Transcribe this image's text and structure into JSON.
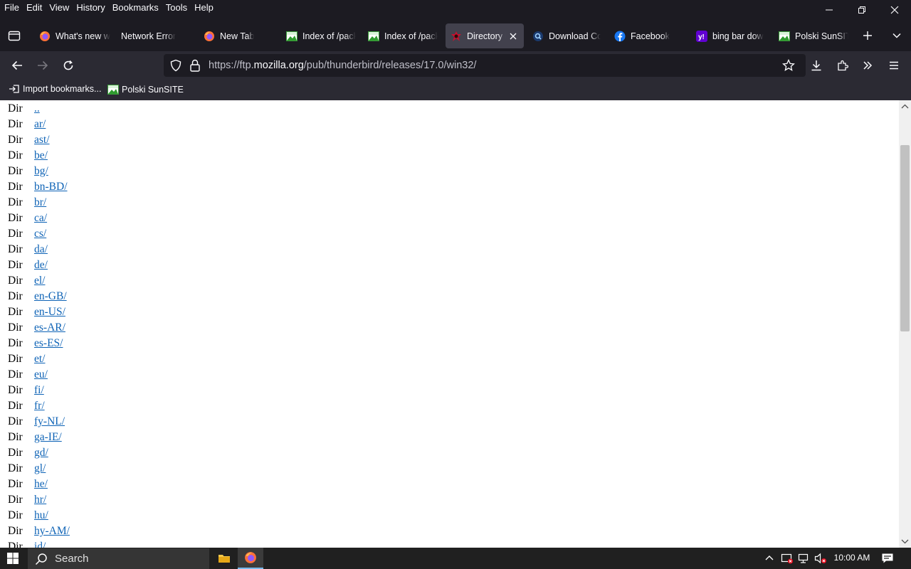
{
  "menu": [
    "File",
    "Edit",
    "View",
    "History",
    "Bookmarks",
    "Tools",
    "Help"
  ],
  "tabs": [
    {
      "label": "What's new w",
      "icon": "firefox-icon"
    },
    {
      "label": "Network Error",
      "icon": "none"
    },
    {
      "label": "New Tab",
      "icon": "firefox-icon"
    },
    {
      "label": "Index of /pack",
      "icon": "sunsite-icon"
    },
    {
      "label": "Index of /pack",
      "icon": "sunsite-icon"
    },
    {
      "label": "Directory L",
      "icon": "directory-icon",
      "active": true
    },
    {
      "label": "Download Co",
      "icon": "search-engine-icon"
    },
    {
      "label": "Facebook",
      "icon": "facebook-icon"
    },
    {
      "label": "bing bar dow",
      "icon": "yahoo-icon"
    },
    {
      "label": "Polski SunSITE",
      "icon": "sunsite-icon"
    }
  ],
  "url": {
    "prefix": "https://ftp.",
    "domain": "mozilla.org",
    "path": "/pub/thunderbird/releases/17.0/win32/"
  },
  "bookmarks": {
    "import": "Import bookmarks...",
    "sunsite": "Polski SunSITE"
  },
  "listing": {
    "kind": "Dir",
    "entries": [
      "..",
      "ar/",
      "ast/",
      "be/",
      "bg/",
      "bn-BD/",
      "br/",
      "ca/",
      "cs/",
      "da/",
      "de/",
      "el/",
      "en-GB/",
      "en-US/",
      "es-AR/",
      "es-ES/",
      "et/",
      "eu/",
      "fi/",
      "fr/",
      "fy-NL/",
      "ga-IE/",
      "gd/",
      "gl/",
      "he/",
      "hr/",
      "hu/",
      "hy-AM/",
      "id/"
    ]
  },
  "taskbar": {
    "search": "Search",
    "time": "10:00 AM"
  },
  "colors": {
    "chrome_dark": "#1c1b22",
    "toolbar": "#2b2a33",
    "link": "#0e63b6",
    "active_tab": "#42414d"
  }
}
